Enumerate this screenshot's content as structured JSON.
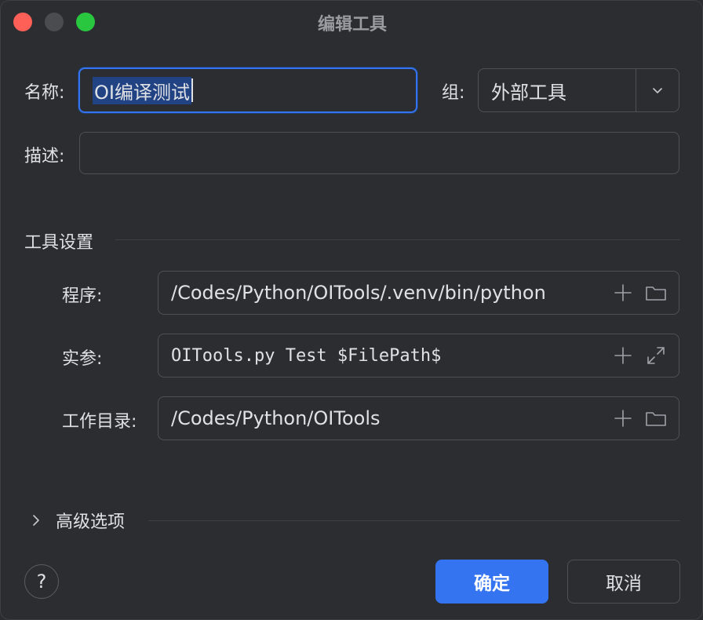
{
  "window": {
    "title": "编辑工具"
  },
  "form": {
    "name_label": "名称:",
    "name_value": "OI编译测试",
    "group_label": "组:",
    "group_value": "外部工具",
    "description_label": "描述:",
    "description_value": ""
  },
  "tool_settings": {
    "section_title": "工具设置",
    "program_label": "程序:",
    "program_value": "/Codes/Python/OITools/.venv/bin/python",
    "arguments_label": "实参:",
    "arguments_value": "OITools.py Test $FilePath$",
    "working_dir_label": "工作目录:",
    "working_dir_value": "/Codes/Python/OITools"
  },
  "advanced": {
    "label": "高级选项",
    "expanded": false
  },
  "footer": {
    "help_label": "?",
    "ok_label": "确定",
    "cancel_label": "取消"
  },
  "icons": {
    "add": "plus-icon",
    "browse": "folder-icon",
    "expand": "expand-icon",
    "dropdown": "chevron-down-icon",
    "section_toggle": "chevron-right-icon"
  },
  "colors": {
    "background": "#2b2d30",
    "accent": "#3574f0",
    "close": "#fe5f57",
    "minimize": "#4a4c50",
    "maximize": "#29c740"
  }
}
